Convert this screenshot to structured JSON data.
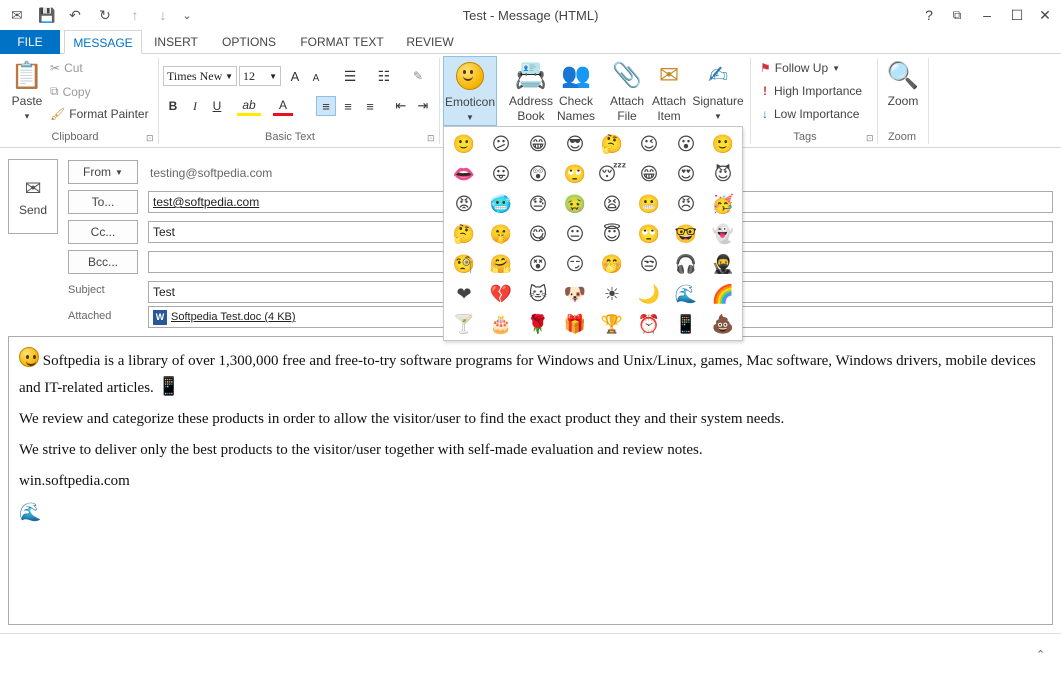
{
  "window": {
    "title": "Test - Message (HTML)",
    "help": "?",
    "restore": "⧉",
    "minimize": "–",
    "maximize": "☐",
    "close": "✕"
  },
  "qat": {
    "app": "✉",
    "save": "💾",
    "undo": "↶",
    "redo": "↻",
    "up": "↑",
    "down": "↓",
    "customize": "⌄"
  },
  "tabs": [
    "FILE",
    "MESSAGE",
    "INSERT",
    "OPTIONS",
    "FORMAT TEXT",
    "REVIEW"
  ],
  "ribbon": {
    "clipboard": {
      "paste": "Paste",
      "paste_arrow": "▾",
      "cut": "Cut",
      "copy": "Copy",
      "format_painter": "Format Painter",
      "label": "Clipboard"
    },
    "basic_text": {
      "font": "Times New",
      "size": "12",
      "grow": "A",
      "shrink": "A",
      "bullets": "☰",
      "numbering": "☷",
      "bold": "B",
      "italic": "I",
      "underline": "U",
      "highlight": "ab",
      "font_color": "A",
      "label": "Basic Text"
    },
    "include": {
      "emoticon": "Emoticon",
      "address_book": [
        "Address",
        "Book"
      ],
      "check_names": [
        "Check",
        "Names"
      ],
      "attach_file": [
        "Attach",
        "File"
      ],
      "attach_item": [
        "Attach",
        "Item"
      ],
      "signature": "Signature"
    },
    "tags": {
      "follow_up": "Follow Up",
      "high_importance": "High Importance",
      "low_importance": "Low Importance",
      "label": "Tags"
    },
    "zoom": {
      "zoom": "Zoom",
      "label": "Zoom"
    },
    "expanders": [
      "⊡",
      "⊡",
      "⊡"
    ]
  },
  "header": {
    "send": "Send",
    "from_btn": "From",
    "from_value": "testing@softpedia.com",
    "to_btn": "To...",
    "to_value": "test@softpedia.com",
    "cc_btn": "Cc...",
    "cc_value": "Test",
    "bcc_btn": "Bcc...",
    "bcc_value": "",
    "subject_label": "Subject",
    "subject_value": "Test",
    "attached_label": "Attached",
    "attached_value": "Softpedia Test.doc (4 KB)"
  },
  "body": {
    "p1": "Softpedia is a library of over 1,300,000 free and free-to-try software programs for Windows and Unix/Linux, games, Mac software, Windows drivers, mobile devices and IT-related articles.",
    "p2": "We review and categorize these products in order to allow the visitor/user to find the exact product they and their system needs.",
    "p3": "We strive to deliver only the best products to the visitor/user together with self-made evaluation and review notes.",
    "p4": "win.softpedia.com",
    "smiley": "🙂",
    "phone": "📱",
    "wave": "🌊"
  },
  "emoticons": [
    [
      "🙂",
      "😕",
      "😁",
      "😎",
      "🤔",
      "😉",
      "😮",
      "🙂"
    ],
    [
      "👄",
      "😛",
      "😲",
      "🙄",
      "😴",
      "😁",
      "😍",
      "😈"
    ],
    [
      "😡",
      "🥶",
      "😓",
      "🤢",
      "😫",
      "😬",
      "😠",
      "🥳"
    ],
    [
      "🤔",
      "🤫",
      "😋",
      "😐",
      "😇",
      "🙄",
      "🤓",
      "👻"
    ],
    [
      "🧐",
      "🤗",
      "😵",
      "😏",
      "🤭",
      "😒",
      "🎧",
      "🥷"
    ],
    [
      "❤",
      "💔",
      "🐱",
      "🐶",
      "☀",
      "🌙",
      "🌊",
      "🌈"
    ],
    [
      "🍸",
      "🎂",
      "🌹",
      "🎁",
      "🏆",
      "⏰",
      "📱",
      "💩"
    ]
  ],
  "colors": {
    "accent": "#0072c6",
    "emoticon_selected": "#cde6f7"
  }
}
